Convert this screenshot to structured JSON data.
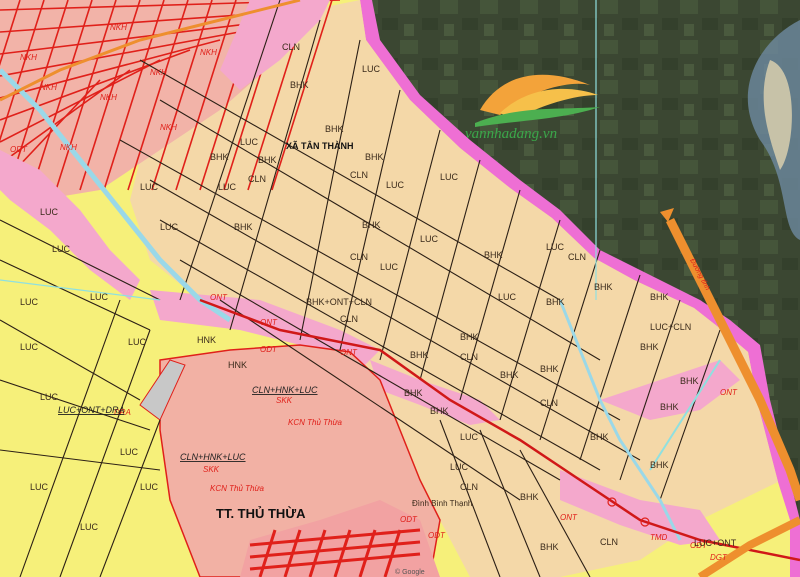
{
  "watermark": {
    "text": "vannhadang.vn"
  },
  "places": [
    {
      "key": "xa_tan_thanh",
      "text": "XÃ TÂN THÀNH"
    },
    {
      "key": "tt_thu_thua",
      "text": "TT. THỦ THỪA"
    },
    {
      "key": "kcn_1",
      "text": "KCN Thủ Thừa"
    },
    {
      "key": "kcn_2",
      "text": "KCN Thủ Thừa"
    },
    {
      "key": "dinh",
      "text": "Đình Bình Thạnh"
    },
    {
      "key": "rd_edge",
      "text": "Đường tỉnh"
    },
    {
      "key": "copy",
      "text": "© Google"
    }
  ],
  "zone_labels": [
    "LUC",
    "BHK",
    "CLN",
    "ONT",
    "ODT",
    "NKH",
    "SKK",
    "DGT",
    "DRA",
    "TMD",
    "CLN+HNK+LUC",
    "BHK+ONT+CLN",
    "LUC+ONT+DRA",
    "LUC+CLN",
    "LUC+ONT",
    "HNK"
  ],
  "colors": {
    "luc": "#f6f07a",
    "bhk": "#f4d8a8",
    "cln": "#f2cfa2",
    "ont": "#f4a8cc",
    "industrial": "#f2b1a4",
    "boundary": "#e96fd4",
    "road": "#ee8f2e",
    "roadline": "#d01818",
    "satellite": "#3c4a33",
    "canal": "#9ad8e8"
  }
}
